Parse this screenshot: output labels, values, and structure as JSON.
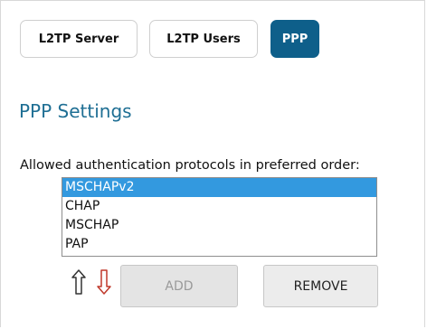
{
  "tabs": [
    {
      "label": "L2TP Server",
      "active": false
    },
    {
      "label": "L2TP Users",
      "active": false
    },
    {
      "label": "PPP",
      "active": true
    }
  ],
  "section": {
    "title": "PPP Settings",
    "description": "Allowed authentication protocols in preferred order:"
  },
  "protocols": {
    "items": [
      "MSCHAPv2",
      "CHAP",
      "MSCHAP",
      "PAP"
    ],
    "selected": "MSCHAPv2"
  },
  "controls": {
    "move_up_icon": "arrow-up-outline-icon",
    "move_down_icon": "arrow-down-outline-icon",
    "add_label": "ADD",
    "add_enabled": false,
    "remove_label": "REMOVE"
  },
  "colors": {
    "accent": "#0e5f8a",
    "title": "#1f6f94",
    "selection": "#3399df",
    "down_arrow": "#c0392b"
  }
}
